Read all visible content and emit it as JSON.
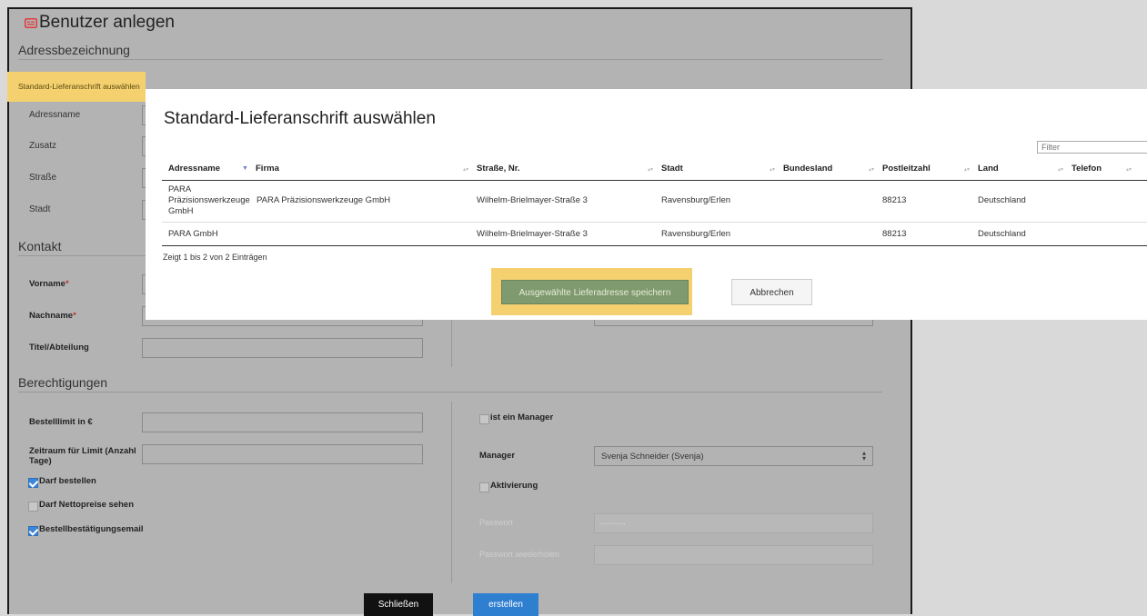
{
  "window": {
    "title": "Benutzer anlegen",
    "title_icon": "id-card-icon",
    "accent": "#e03b3b"
  },
  "sections": {
    "address": "Adressbezeichnung",
    "contact": "Kontakt",
    "permissions": "Berechtigungen"
  },
  "address_fields": {
    "default_delivery_button": "Standard-Lieferanschrift auswählen",
    "address_name": "Adressname",
    "addition": "Zusatz",
    "street": "Straße",
    "city": "Stadt"
  },
  "contact": {
    "first_name": "Vorname",
    "last_name": "Nachname",
    "required_mark": "*",
    "title_department": "Titel/Abteilung"
  },
  "permissions": {
    "order_limit": "Bestelllimit in €",
    "limit_period": "Zeitraum für Limit (Anzahl Tage)",
    "may_order": "Darf bestellen",
    "may_order_checked": true,
    "see_net_prices": "Darf Nettopreise sehen",
    "see_net_prices_checked": false,
    "order_confirmation_email": "Bestellbestätigungsemail",
    "order_confirmation_email_checked": true,
    "is_manager": "ist ein Manager",
    "is_manager_checked": false,
    "manager_label": "Manager",
    "manager_value": "Svenja Schneider (Svenja)",
    "activation": "Aktivierung",
    "activation_checked": false,
    "password": "Passwort",
    "password_value": "..........",
    "password_repeat": "Passwort wiederholen"
  },
  "footer": {
    "close_button": "Schließen",
    "create_button": "erstellen"
  },
  "modal": {
    "title": "Standard-Lieferanschrift auswählen",
    "filter_placeholder": "Filter",
    "columns": [
      "Adressname",
      "Firma",
      "Straße, Nr.",
      "Stadt",
      "Bundesland",
      "Postleitzahl",
      "Land",
      "Telefon"
    ],
    "rows": [
      {
        "address_name": "PARA Präzisionswerkzeuge GmbH",
        "address_name_lines": [
          "PARA",
          "Präzisionswerkzeuge",
          "GmbH"
        ],
        "company": "PARA Präzisionswerkzeuge GmbH",
        "street": "Wilhelm-Brielmayer-Straße 3",
        "city": "Ravensburg/Erlen",
        "state": "",
        "zip": "88213",
        "country": "Deutschland",
        "phone": ""
      },
      {
        "address_name": "PARA GmbH",
        "company": "",
        "street": "Wilhelm-Brielmayer-Straße 3",
        "city": "Ravensburg/Erlen",
        "state": "",
        "zip": "88213",
        "country": "Deutschland",
        "phone": ""
      }
    ],
    "info": "Zeigt 1 bis 2 von 2 Einträgen",
    "save_button": "Ausgewählte Lieferadresse speichern",
    "cancel_button": "Abbrechen"
  },
  "colors": {
    "highlight": "#f4d06f",
    "save_button": "#7e9a6e",
    "create_button": "#2f7fd1",
    "close_button": "#111111"
  }
}
